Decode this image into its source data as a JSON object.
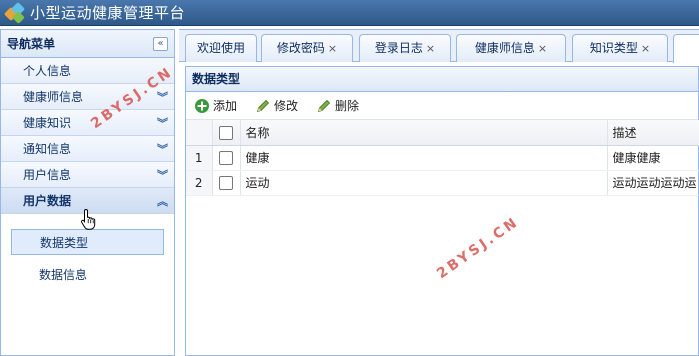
{
  "app": {
    "title": "小型运动健康管理平台"
  },
  "sidebar": {
    "title": "导航菜单",
    "collapse_glyph": "«",
    "items": [
      {
        "label": "个人信息",
        "chevron": ""
      },
      {
        "label": "健康师信息",
        "chevron": "︾"
      },
      {
        "label": "健康知识",
        "chevron": "︾"
      },
      {
        "label": "通知信息",
        "chevron": "︾"
      },
      {
        "label": "用户信息",
        "chevron": "︾"
      },
      {
        "label": "用户数据",
        "chevron": "︽"
      }
    ],
    "subitems": [
      {
        "label": "数据类型"
      },
      {
        "label": "数据信息"
      }
    ]
  },
  "tabs": [
    {
      "label": "欢迎使用",
      "close": ""
    },
    {
      "label": "修改密码",
      "close": "×"
    },
    {
      "label": "登录日志",
      "close": "×"
    },
    {
      "label": "健康师信息",
      "close": "×"
    },
    {
      "label": "知识类型",
      "close": "×"
    }
  ],
  "panel": {
    "title": "数据类型",
    "toolbar": {
      "add": "添加",
      "edit": "修改",
      "delete": "删除"
    }
  },
  "grid": {
    "columns": {
      "name": "名称",
      "desc": "描述"
    },
    "rows": [
      {
        "num": "1",
        "name": "健康",
        "desc": "健康健康"
      },
      {
        "num": "2",
        "name": "运动",
        "desc": "运动运动运动运"
      }
    ]
  },
  "watermark": {
    "text": "2BYSJ.CN",
    "color": "#d9534f"
  },
  "colors": {
    "titlebar": "#2d5889",
    "border": "#95b8e7",
    "accent": "#0e2d5f"
  }
}
